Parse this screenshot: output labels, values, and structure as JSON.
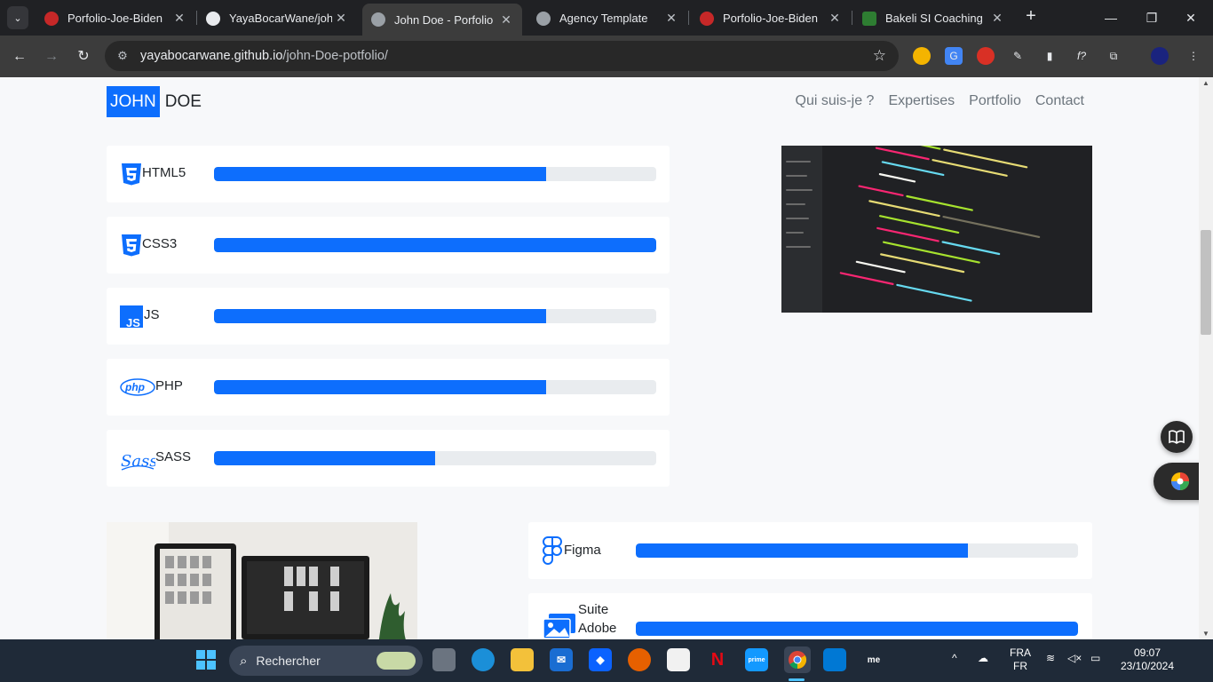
{
  "browser": {
    "tabs": [
      {
        "title": "Porfolio-Joe-Biden",
        "active": false,
        "favicon": "red-app-icon"
      },
      {
        "title": "YayaBocarWane/john",
        "active": false,
        "favicon": "github-icon"
      },
      {
        "title": "John Doe - Porfolio",
        "active": true,
        "favicon": "globe-icon"
      },
      {
        "title": "Agency Template",
        "active": false,
        "favicon": "globe-icon"
      },
      {
        "title": "Porfolio-Joe-Biden",
        "active": false,
        "favicon": "red-app-icon"
      },
      {
        "title": "Bakeli SI Coaching",
        "active": false,
        "favicon": "bakeli-icon"
      }
    ],
    "url_host": "yayabocarwane.github.io",
    "url_path": "/john-Doe-potfolio/"
  },
  "site": {
    "brand_highlight": "JOHN",
    "brand_rest": "DOE",
    "nav": [
      "Qui suis-je ?",
      "Expertises",
      "Portfolio",
      "Contact"
    ]
  },
  "skills": [
    {
      "label": "HTML5",
      "level": 0.75,
      "icon": "html5-icon"
    },
    {
      "label": "CSS3",
      "level": 1.0,
      "icon": "css3-icon"
    },
    {
      "label": "JS",
      "level": 0.75,
      "icon": "js-icon"
    },
    {
      "label": "PHP",
      "level": 0.75,
      "icon": "php-icon"
    },
    {
      "label": "SASS",
      "level": 0.5,
      "icon": "sass-icon"
    }
  ],
  "design_skills": [
    {
      "label": "Figma",
      "level": 0.75,
      "icon": "figma-icon"
    },
    {
      "label": "Suite Adobe",
      "level": 1.0,
      "icon": "adobe-suite-icon"
    }
  ],
  "colors": {
    "accent": "#0d6efd",
    "track": "#e9ecef"
  },
  "taskbar": {
    "search_label": "Rechercher",
    "lang_top": "FRA",
    "lang_bottom": "FR",
    "time": "09:07",
    "date": "23/10/2024"
  }
}
